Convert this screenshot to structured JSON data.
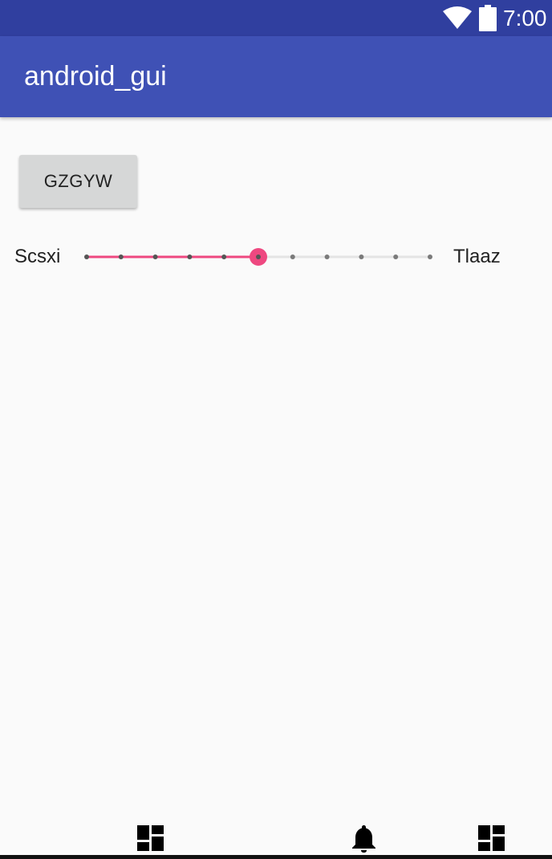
{
  "status_bar": {
    "time": "7:00",
    "icons": [
      "wifi-icon",
      "battery-icon"
    ],
    "background": "#303f9f"
  },
  "app_bar": {
    "title": "android_gui",
    "background": "#3f51b5"
  },
  "main": {
    "button_label": "GZGYW",
    "seekbar": {
      "left_label": "Scsxi",
      "right_label": "Tlaaz",
      "max": 10,
      "progress": 5,
      "accent_color": "#ee4880",
      "inactive_color": "#e4e4e4"
    }
  },
  "nav_bar": {
    "items": [
      "dashboard-icon",
      "bell-icon",
      "dashboard-icon"
    ]
  }
}
